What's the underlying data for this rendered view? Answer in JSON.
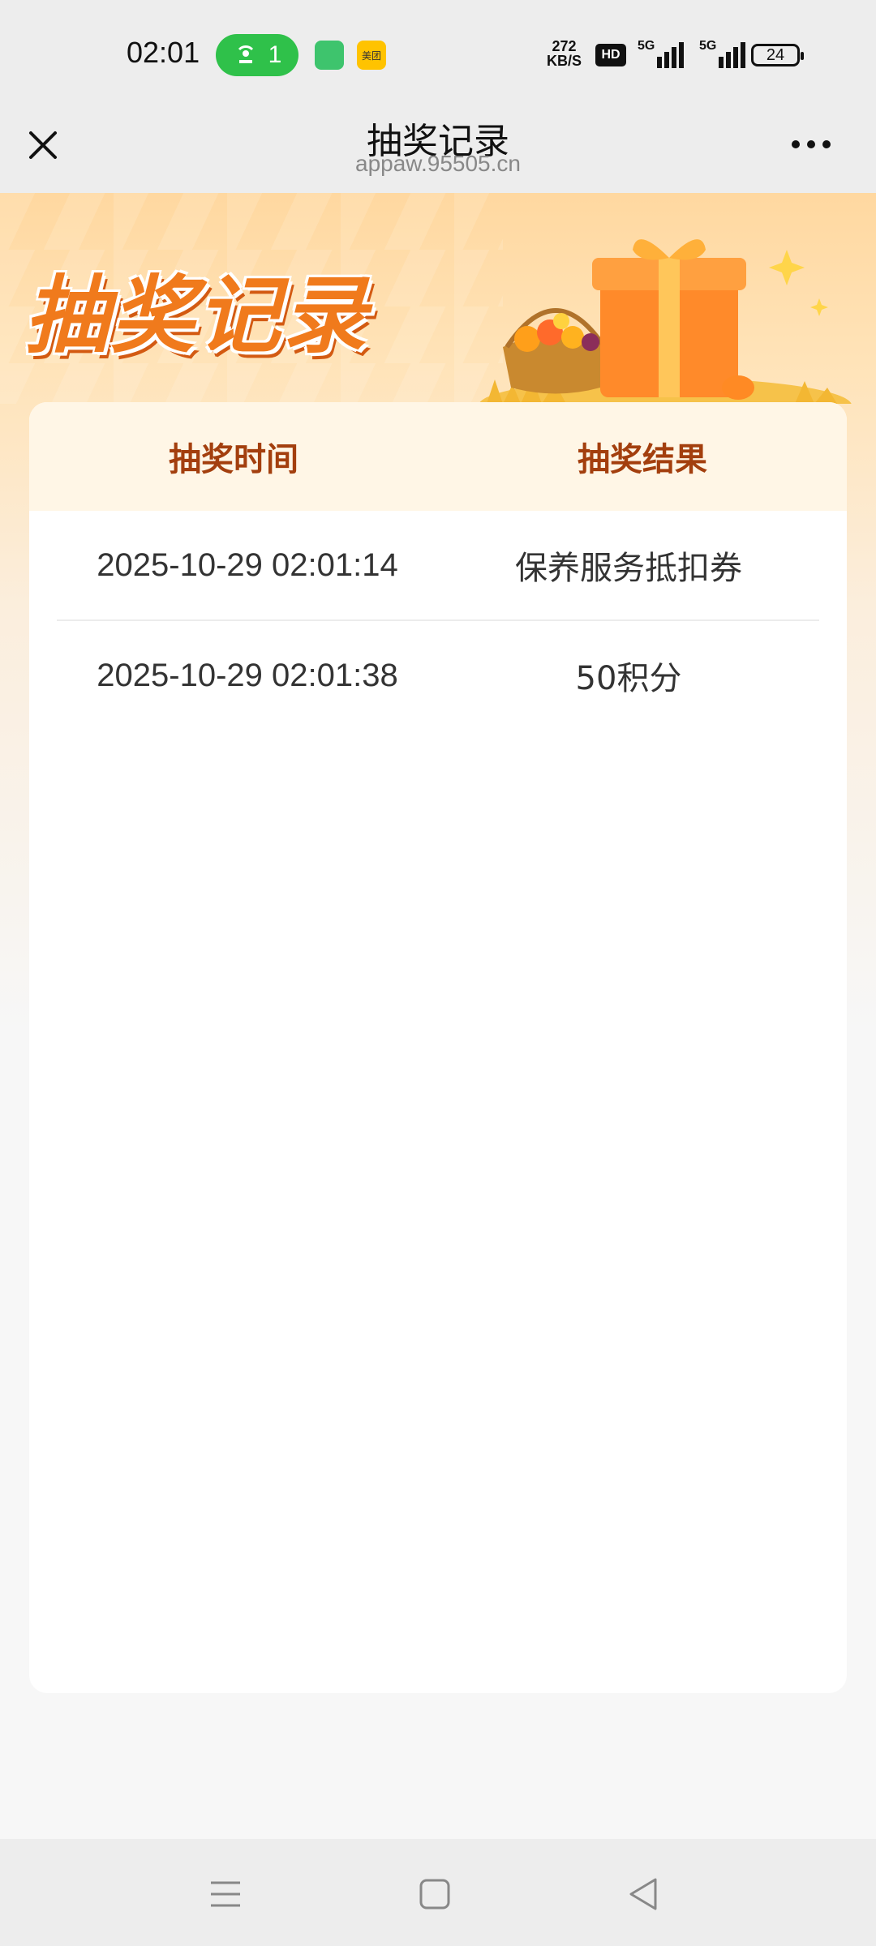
{
  "status": {
    "time": "02:01",
    "hotspot_count": "1",
    "meituan_label": "美团",
    "net_speed_value": "272",
    "net_speed_unit": "KB/S",
    "hd_label": "HD",
    "sim1_label": "5G",
    "sim2_label": "5G",
    "battery": "24"
  },
  "titlebar": {
    "title": "抽奖记录",
    "url": "appaw.95505.cn"
  },
  "hero": {
    "title": "抽奖记录"
  },
  "table": {
    "headers": [
      "抽奖时间",
      "抽奖结果"
    ],
    "rows": [
      {
        "time": "2025-10-29 02:01:14",
        "result": "保养服务抵扣券"
      },
      {
        "time": "2025-10-29 02:01:38",
        "result": "50积分"
      }
    ]
  },
  "colors": {
    "accent": "#f07a1c",
    "header_text": "#a33f0e",
    "header_bg": "#fff6e6"
  }
}
